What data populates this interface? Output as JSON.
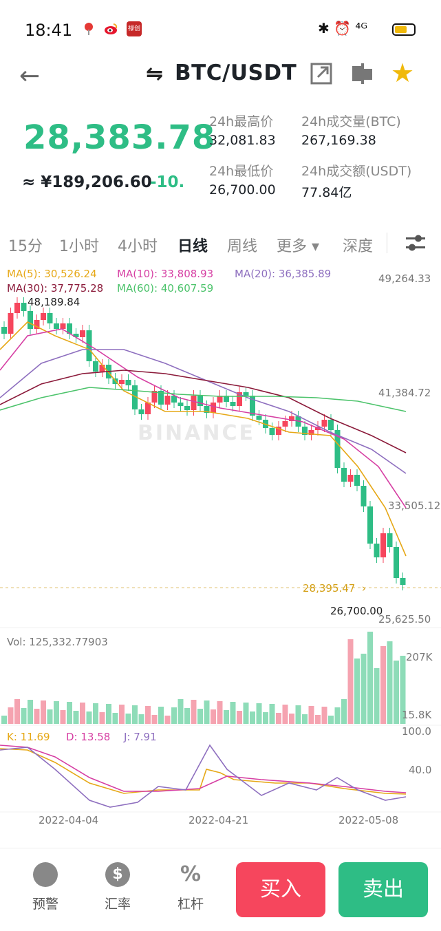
{
  "status_bar": {
    "time": "18:41",
    "app_icon_2_text": "微博",
    "app_icon_3_text": "禄创",
    "right_icons": "✱ ⏰ ⁴ᴳ",
    "icons": [
      "location-pin-icon",
      "weibo-icon",
      "app-icon",
      "bluetooth-icon",
      "alarm-icon",
      "4g-signal-icon",
      "battery-icon"
    ]
  },
  "header": {
    "title": "BTC/USDT",
    "swap_glyph": "⇋",
    "icons": [
      "back-arrow-icon",
      "swap-icon",
      "share-icon",
      "layout-icon",
      "star-icon"
    ],
    "star_color": "#f0b90b"
  },
  "ticker": {
    "last_price": "28,383.78",
    "cny_price": "≈ ¥189,206.60",
    "change": "-10.",
    "high_label": "24h最高价",
    "high_value": "32,081.83",
    "low_label": "24h最低价",
    "low_value": "26,700.00",
    "vol_btc_label": "24h成交量(BTC)",
    "vol_btc_value": "267,169.38",
    "vol_usdt_label": "24h成交额(USDT)",
    "vol_usdt_value": "77.84亿",
    "price_color": "#2ebd85"
  },
  "tabs": [
    {
      "label": "15分"
    },
    {
      "label": "1小时"
    },
    {
      "label": "4小时"
    },
    {
      "label": "日线"
    },
    {
      "label": "周线"
    },
    {
      "label": "更多 ▾"
    },
    {
      "label": "深度"
    }
  ],
  "chart": {
    "ma5": "MA(5): 30,526.24",
    "ma10": "MA(10): 33,808.93",
    "ma20": "MA(20): 36,385.89",
    "ma30": "MA(30): 37,775.28",
    "ma60": "MA(60): 40,607.59",
    "price_axis": [
      "49,264.33",
      "41,384.72",
      "33,505.12",
      "25,625.50"
    ],
    "high_marker": "48,189.84",
    "low_marker": "26,700.00",
    "current_price_tag": "28,395.47",
    "vol_label": "Vol: 125,332.77903",
    "vol_axis_top": "207K",
    "vol_axis_bottom": "15.8K",
    "kdj_k": "K: 11.69",
    "kdj_d": "D: 13.58",
    "kdj_j": "J: 7.91",
    "kdj_axis_top": "100.0",
    "kdj_axis_mid": "40.0",
    "dates": [
      "2022-04-04",
      "2022-04-21",
      "2022-05-08"
    ],
    "watermark": "BINANCE",
    "colors": {
      "up": "#f6465d",
      "down": "#2ebd85",
      "ma5": "#e6a817",
      "ma10": "#d63fa3",
      "ma20": "#8e6fbf",
      "ma30": "#8b1a3a",
      "ma60": "#4cc36b"
    }
  },
  "bottom": {
    "alert_label": "预警",
    "rate_label": "汇率",
    "leverage_label": "杠杆",
    "buy_label": "买入",
    "sell_label": "卖出",
    "icons": [
      "bell-icon",
      "dollar-icon",
      "percent-icon"
    ]
  }
}
